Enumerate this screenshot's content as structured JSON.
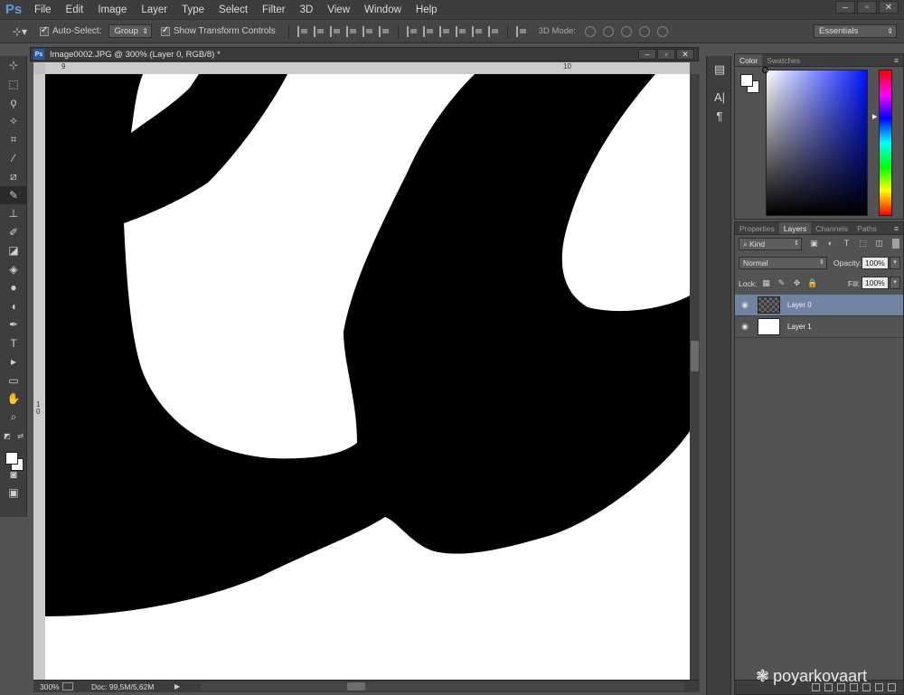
{
  "app": {
    "logo": "Ps"
  },
  "menu": [
    "File",
    "Edit",
    "Image",
    "Layer",
    "Type",
    "Select",
    "Filter",
    "3D",
    "View",
    "Window",
    "Help"
  ],
  "options": {
    "auto_select_label": "Auto-Select:",
    "auto_select_value": "Group",
    "show_transform_label": "Show Transform Controls",
    "mode3d_label": "3D Mode:",
    "workspace": "Essentials"
  },
  "document": {
    "title": "Image0002.JPG @ 300% (Layer 0, RGB/8) *",
    "ruler_top_labels": [
      "9",
      "10"
    ],
    "ruler_left_label": "1\n0",
    "zoom": "300%",
    "doc_size": "Doc: 99,5M/5,62M"
  },
  "color_panel": {
    "tabs": [
      "Color",
      "Swatches"
    ]
  },
  "layers_panel": {
    "tabs": [
      "Properties",
      "Layers",
      "Channels",
      "Paths"
    ],
    "filter_kind": "Kind",
    "blend_mode": "Normal",
    "opacity_label": "Opacity:",
    "opacity_value": "100%",
    "lock_label": "Lock:",
    "fill_label": "Fill:",
    "fill_value": "100%",
    "layers": [
      {
        "name": "Layer 0",
        "selected": true
      },
      {
        "name": "Layer 1",
        "selected": false
      }
    ]
  },
  "watermark": "poyarkovaart"
}
